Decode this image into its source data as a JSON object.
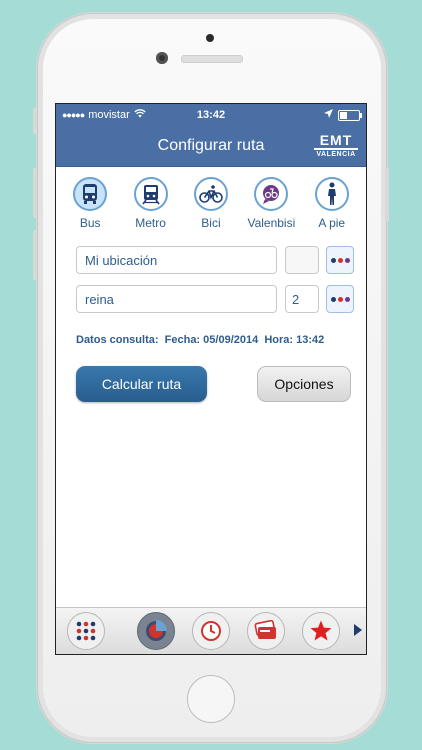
{
  "status_bar": {
    "signal": "●●●●●",
    "carrier": "movistar",
    "time": "13:42"
  },
  "nav": {
    "title": "Configurar ruta",
    "logo_main": "EMT",
    "logo_sub": "VALENCIA"
  },
  "modes": [
    {
      "label": "Bus",
      "icon": "bus-icon",
      "active": true
    },
    {
      "label": "Metro",
      "icon": "metro-icon",
      "active": false
    },
    {
      "label": "Bici",
      "icon": "bicycle-icon",
      "active": false
    },
    {
      "label": "Valenbisi",
      "icon": "valenbisi-icon",
      "active": false
    },
    {
      "label": "A pie",
      "icon": "pedestrian-icon",
      "active": false
    }
  ],
  "origin": {
    "value": "Mi ubicación",
    "number": ""
  },
  "destination": {
    "value": "reina",
    "number": "2"
  },
  "consulta": {
    "label": "Datos consulta:",
    "fecha_label": "Fecha:",
    "fecha": "05/09/2014",
    "hora_label": "Hora:",
    "hora": "13:42"
  },
  "buttons": {
    "calcular": "Calcular ruta",
    "opciones": "Opciones"
  },
  "tabbar": [
    "grid-menu-icon",
    "route-target-icon",
    "clock-icon",
    "cards-icon",
    "star-icon",
    "next-arrow-icon"
  ],
  "colors": {
    "accent": "#4a6fa5",
    "button": "#2f6a9d",
    "text": "#2f5d8c"
  }
}
